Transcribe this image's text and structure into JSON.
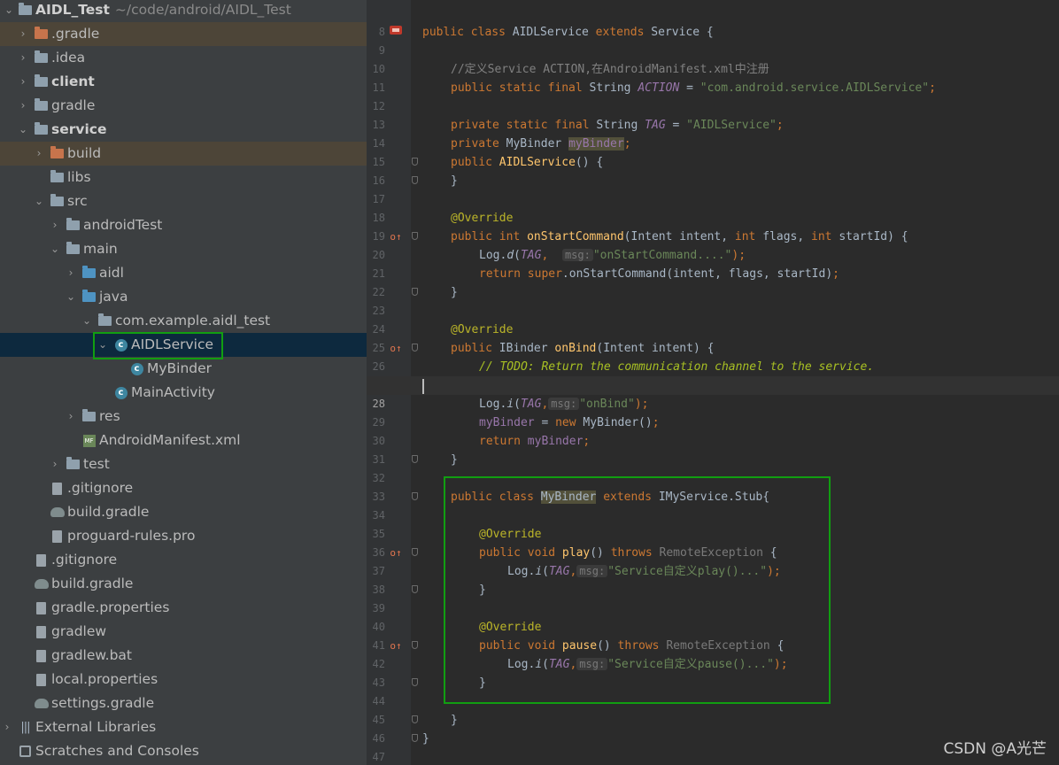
{
  "project": {
    "name": "AIDL_Test",
    "path": "~/code/android/AIDL_Test"
  },
  "tree": {
    "gradle_dir": ".gradle",
    "idea_dir": ".idea",
    "client": "client",
    "gradle": "gradle",
    "service": "service",
    "build": "build",
    "libs": "libs",
    "src": "src",
    "androidTest": "androidTest",
    "main": "main",
    "aidl": "aidl",
    "java": "java",
    "package": "com.example.aidl_test",
    "aidlservice": "AIDLService",
    "mybinder": "MyBinder",
    "mainactivity": "MainActivity",
    "res": "res",
    "manifest": "AndroidManifest.xml",
    "test": "test",
    "svc_gitignore": ".gitignore",
    "svc_build_gradle": "build.gradle",
    "proguard": "proguard-rules.pro",
    "gitignore": ".gitignore",
    "build_gradle": "build.gradle",
    "gradle_properties": "gradle.properties",
    "gradlew": "gradlew",
    "gradlew_bat": "gradlew.bat",
    "local_properties": "local.properties",
    "settings_gradle": "settings.gradle",
    "external_libraries": "External Libraries",
    "scratches": "Scratches and Consoles"
  },
  "editor": {
    "line_numbers": [
      "8",
      "9",
      "10",
      "11",
      "12",
      "13",
      "14",
      "15",
      "16",
      "17",
      "18",
      "19",
      "20",
      "21",
      "22",
      "23",
      "24",
      "25",
      "26",
      "27",
      "28",
      "29",
      "30",
      "31",
      "32",
      "33",
      "34",
      "35",
      "36",
      "37",
      "38",
      "39",
      "40",
      "41",
      "42",
      "43",
      "44",
      "45",
      "46",
      "47"
    ]
  },
  "code": {
    "l9": {
      "kw1": "public class ",
      "name": "AIDLService ",
      "kw2": "extends ",
      "rest": "Service {"
    },
    "l11": "//定义Service ACTION,在AndroidManifest.xml中注册",
    "l12": {
      "kw": "public static final ",
      "type": "String ",
      "const": "ACTION",
      "eq": " = ",
      "str": "\"com.android.service.AIDLService\"",
      "end": ";"
    },
    "l14": {
      "kw": "private static final ",
      "type": "String ",
      "const": "TAG",
      "eq": " = ",
      "str": "\"AIDLService\"",
      "end": ";"
    },
    "l15": {
      "kw": "private ",
      "type": "MyBinder ",
      "field": "myBinder",
      "end": ";"
    },
    "l16": {
      "kw": "public ",
      "fn": "AIDLService",
      "rest": "() {"
    },
    "l17": "}",
    "l19": "@Override",
    "l20": {
      "kw1": "public int ",
      "fn": "onStartCommand",
      "p1": "(Intent intent, ",
      "kw2": "int ",
      "p2": "flags, ",
      "kw3": "int ",
      "p3": "startId) {"
    },
    "l21": {
      "pre": "Log.",
      "m": "d",
      "o": "(",
      "tag": "TAG",
      "c": ", ",
      "hint": "msg:",
      "str": "\"onStartCommand....\"",
      "end": ");"
    },
    "l22": {
      "kw": "return super",
      "rest": ".onStartCommand(intent, flags, startId)",
      "end": ";"
    },
    "l23": "}",
    "l25": "@Override",
    "l26": {
      "kw": "public ",
      "type": "IBinder ",
      "fn": "onBind",
      "rest": "(Intent intent) {"
    },
    "l27": {
      "cmt": "// ",
      "todo": "TODO: Return the communication channel to the service."
    },
    "l29": {
      "pre": "Log.",
      "m": "i",
      "o": "(",
      "tag": "TAG",
      "c": ",",
      "hint": "msg:",
      "str": "\"onBind\"",
      "end": ");"
    },
    "l30": {
      "field": "myBinder",
      "eq": " = ",
      "kw": "new ",
      "rest": "MyBinder()",
      "end": ";"
    },
    "l31": {
      "kw": "return ",
      "field": "myBinder",
      "end": ";"
    },
    "l32": "}",
    "l34": {
      "kw1": "public class ",
      "name": "MyBinder",
      "kw2": " extends ",
      "rest": "IMyService.Stub{"
    },
    "l36": "@Override",
    "l37": {
      "kw": "public void ",
      "fn": "play",
      "p": "() ",
      "kw2": "throws ",
      "exc": "RemoteException",
      "rest": " {"
    },
    "l38": {
      "pre": "Log.",
      "m": "i",
      "o": "(",
      "tag": "TAG",
      "c": ",",
      "hint": "msg:",
      "str": "\"Service自定义play()...\"",
      "end": ");"
    },
    "l39": "}",
    "l41": "@Override",
    "l42": {
      "kw": "public void ",
      "fn": "pause",
      "p": "() ",
      "kw2": "throws ",
      "exc": "RemoteException",
      "rest": " {"
    },
    "l43": {
      "pre": "Log.",
      "m": "i",
      "o": "(",
      "tag": "TAG",
      "c": ",",
      "hint": "msg:",
      "str": "\"Service自定义pause()...\"",
      "end": ");"
    },
    "l44": "}",
    "l46": "}",
    "l47": "}"
  },
  "watermark": "CSDN @A光芒",
  "colors": {
    "selection_outline": "#119e11",
    "keyword": "#cc7832",
    "string": "#6a8759"
  }
}
